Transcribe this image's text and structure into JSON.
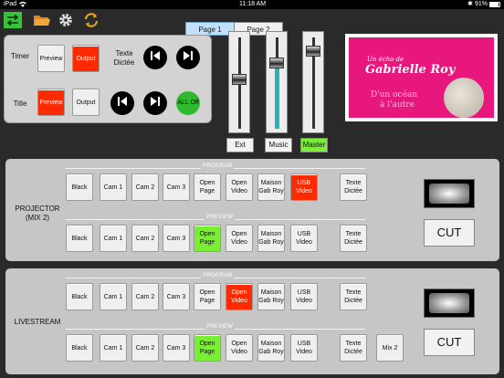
{
  "status_bar": {
    "device": "iPad",
    "time": "11:18 AM",
    "battery": "91%",
    "wifi_icon": "wifi-icon",
    "bluetooth_icon": "bluetooth-icon"
  },
  "toolbar": {
    "icons": [
      "swap-icon",
      "folder-icon",
      "gear-icon",
      "refresh-icon"
    ],
    "tabs": [
      {
        "label": "Page 1",
        "active": true
      },
      {
        "label": "Page 2",
        "active": false
      }
    ]
  },
  "controls": {
    "timer_label": "Timer",
    "timer_preview": "Preview",
    "timer_output": "Output",
    "dictee_label": "Texte Dictée",
    "title_label": "Title",
    "title_preview": "Preview",
    "title_output": "Output",
    "all_off": "ALL Off"
  },
  "faders": [
    {
      "label": "Ext",
      "level": 0.55,
      "active": false,
      "fill": false
    },
    {
      "label": "Music",
      "level": 0.75,
      "active": false,
      "fill": true
    },
    {
      "label": "Master",
      "level": 0.9,
      "active": true,
      "fill": false
    }
  ],
  "preview_image": {
    "line1": "Un écho de",
    "line2": "Gabrielle Roy",
    "line3": "D'un océan",
    "line4": "à l'autre",
    "bg_color": "#e8177d"
  },
  "projector": {
    "label": "PROJECTOR (MIX 2)",
    "program_label": "PROGRAM",
    "preview_label": "PREVIEW",
    "cut": "CUT",
    "program": [
      "Black",
      "Cam 1",
      "Cam 2",
      "Cam 3",
      "Open Page",
      "Open Video",
      "Maison Gab Roy",
      "USB Video",
      "Texte Dictée"
    ],
    "program_active": "USB Video",
    "preview": [
      "Black",
      "Cam 1",
      "Cam 2",
      "Cam 3",
      "Open Page",
      "Open Video",
      "Maison Gab Roy",
      "USB Video",
      "Texte Dictée"
    ],
    "preview_active": "Open Page"
  },
  "livestream": {
    "label": "LIVESTREAM",
    "program_label": "PROGRAM",
    "preview_label": "PREVIEW",
    "cut": "CUT",
    "program": [
      "Black",
      "Cam 1",
      "Cam 2",
      "Cam 3",
      "Open Page",
      "Open Video",
      "Maison Gab Roy",
      "USB Video",
      "Texte Dictée"
    ],
    "program_active": "Open Video",
    "preview": [
      "Black",
      "Cam 1",
      "Cam 2",
      "Cam 3",
      "Open Page",
      "Open Video",
      "Maison Gab Roy",
      "USB Video",
      "Texte Dictée",
      "Mix 2"
    ],
    "preview_active": "Open Page"
  },
  "colors": {
    "active_program": "#ff2a00",
    "active_preview": "#79ef34",
    "fader_fill": "#26b3b7"
  }
}
